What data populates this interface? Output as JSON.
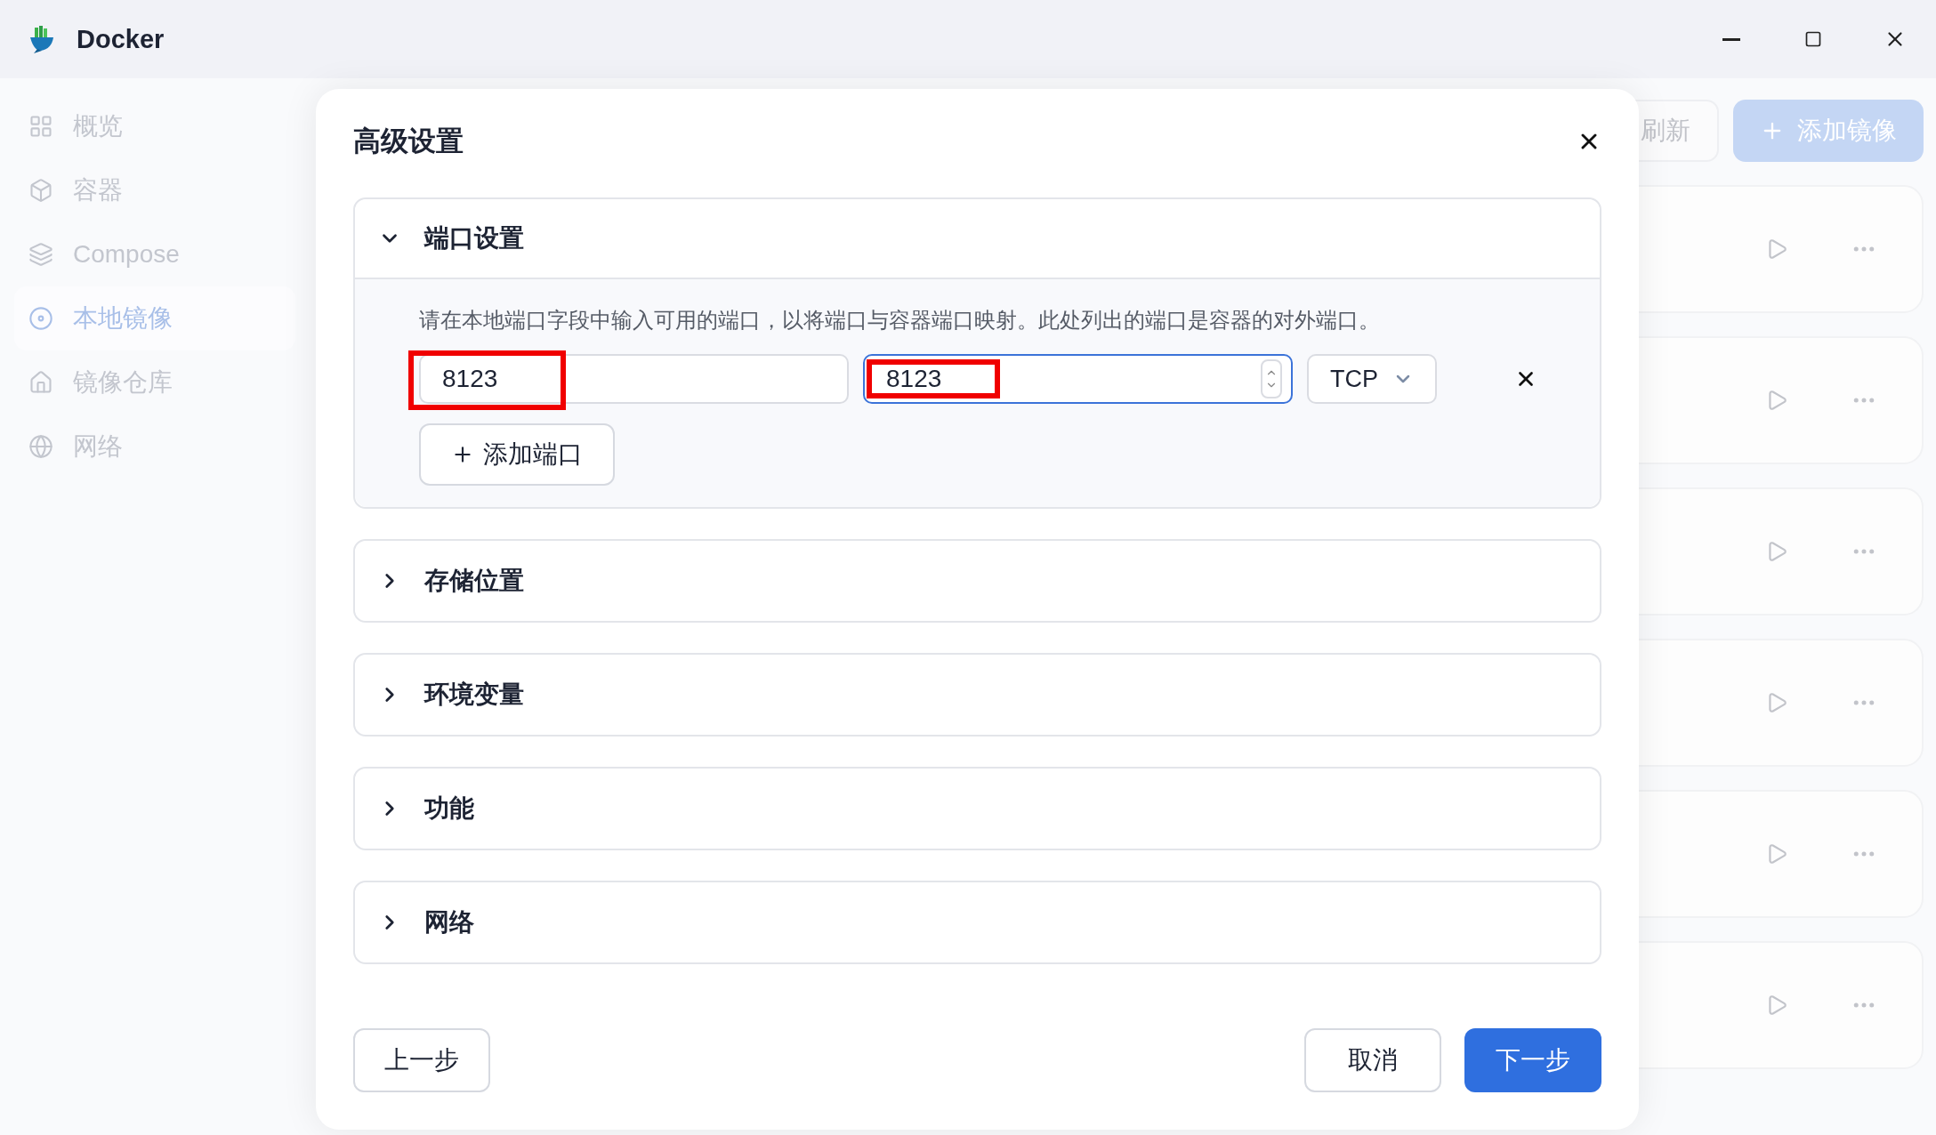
{
  "window": {
    "title": "Docker"
  },
  "sidebar": {
    "items": [
      {
        "label": "概览",
        "selected": false
      },
      {
        "label": "容器",
        "selected": false
      },
      {
        "label": "Compose",
        "selected": false
      },
      {
        "label": "本地镜像",
        "selected": true
      },
      {
        "label": "镜像仓库",
        "selected": false
      },
      {
        "label": "网络",
        "selected": false
      }
    ]
  },
  "toolbar": {
    "buttons": [
      {
        "label": "刷新",
        "kind": "secondary"
      },
      {
        "label": "添加镜像",
        "kind": "primary"
      }
    ]
  },
  "image_rows": [
    {
      "kind": "image"
    },
    {
      "kind": "image"
    },
    {
      "kind": "image"
    },
    {
      "kind": "image"
    },
    {
      "kind": "image"
    },
    {
      "kind": "image"
    }
  ],
  "dialog": {
    "title": "高级设置",
    "sections": [
      {
        "title": "端口设置",
        "expanded": true,
        "description": "请在本地端口字段中输入可用的端口，以将端口与容器端口映射。此处列出的端口是容器的对外端口。",
        "ports": [
          {
            "host": {
              "value": "8123",
              "focused": false,
              "annotated": true
            },
            "container": {
              "value": "8123",
              "focused": true,
              "annotated": true
            },
            "protocol": "TCP"
          }
        ],
        "add_button": "添加端口"
      },
      {
        "title": "存储位置",
        "expanded": false
      },
      {
        "title": "环境变量",
        "expanded": false
      },
      {
        "title": "功能",
        "expanded": false
      },
      {
        "title": "网络",
        "expanded": false
      }
    ],
    "footer": {
      "back": "上一步",
      "cancel": "取消",
      "next": "下一步"
    }
  }
}
